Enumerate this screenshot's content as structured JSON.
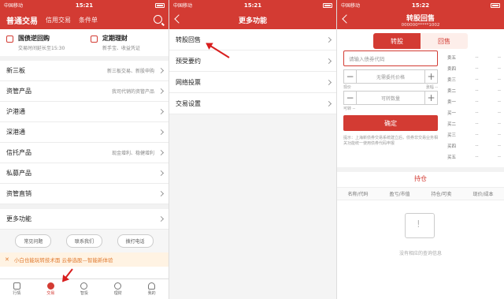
{
  "screen1": {
    "status": {
      "carrier": "中国移动",
      "time": "15:21"
    },
    "tabs": [
      "普通交易",
      "信用交易",
      "条件单"
    ],
    "promo": [
      {
        "title": "国债逆回购",
        "sub": "交易时间延长至15:30"
      },
      {
        "title": "定期理财",
        "sub": "新手宝、收益凭证"
      }
    ],
    "rows": [
      {
        "label": "新三板",
        "desc": "新三板交易、新股申购"
      },
      {
        "label": "资管产品",
        "desc": "我司代销的资管产品"
      },
      {
        "label": "沪港通",
        "desc": ""
      },
      {
        "label": "深港通",
        "desc": ""
      },
      {
        "label": "信托产品",
        "desc": "现金增利、稳健增利"
      },
      {
        "label": "私募产品",
        "desc": ""
      },
      {
        "label": "资管直销",
        "desc": ""
      }
    ],
    "more": "更多功能",
    "pills": [
      "常见问题",
      "联系我们",
      "拨打电话"
    ],
    "banner": "小白也能玩转技术面  云参选股—智能新体验",
    "nav": [
      "行情",
      "交易",
      "智投",
      "理财",
      "我的"
    ]
  },
  "screen2": {
    "status": {
      "carrier": "中国移动",
      "time": "15:21"
    },
    "title": "更多功能",
    "items": [
      "转股回售",
      "预受要约",
      "网络投票",
      "交易设置"
    ]
  },
  "screen3": {
    "status": {
      "carrier": "中国移动",
      "time": "15:22"
    },
    "title": "转股回售",
    "account": "000000*****1002",
    "seg": [
      "转股",
      "回售"
    ],
    "code_placeholder": "请输入债券代码",
    "price_placeholder": "无需委托价格",
    "price_left": "现价",
    "price_right": "涨幅 --",
    "qty_placeholder": "可转数量",
    "qty_left": "可转 --",
    "confirm": "确定",
    "notice": "提示：上海新债券交易系统建立后，债券非交易业务相关功能统一使用债券代码申报",
    "quotes": [
      {
        "label": "卖五",
        "v1": "--",
        "v2": "--"
      },
      {
        "label": "卖四",
        "v1": "--",
        "v2": "--"
      },
      {
        "label": "卖三",
        "v1": "--",
        "v2": "--"
      },
      {
        "label": "卖二",
        "v1": "--",
        "v2": "--"
      },
      {
        "label": "卖一",
        "v1": "--",
        "v2": "--"
      },
      {
        "label": "买一",
        "v1": "--",
        "v2": "--"
      },
      {
        "label": "买二",
        "v1": "--",
        "v2": "--"
      },
      {
        "label": "买三",
        "v1": "--",
        "v2": "--"
      },
      {
        "label": "买四",
        "v1": "--",
        "v2": "--"
      },
      {
        "label": "买五",
        "v1": "--",
        "v2": "--"
      }
    ],
    "hold_title": "持仓",
    "hold_cols": [
      "名称/代码",
      "盈亏/市值",
      "持仓/可卖",
      "现价/成本"
    ],
    "empty": "没有相应的查询信息"
  }
}
